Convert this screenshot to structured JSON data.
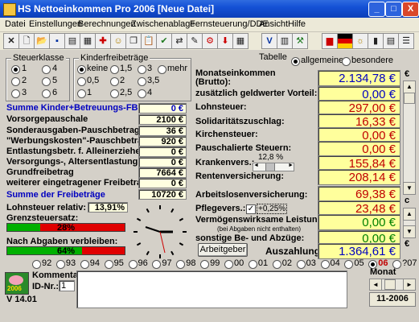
{
  "window": {
    "title": "HS  Nettoeinkommen Pro 2006 [Neue Datei]",
    "btn_min": "_",
    "btn_max": "□",
    "btn_close": "X"
  },
  "menu": [
    "Datei",
    "Einstellungen",
    "Berechnungen",
    "Zwischenablage",
    "Fernsteuerung/DDE",
    "Ansicht",
    "Hilfe"
  ],
  "steuerklasse": {
    "title": "Steuerklasse",
    "options": [
      "1",
      "2",
      "3",
      "4",
      "5",
      "6"
    ],
    "selected": "1"
  },
  "kinder": {
    "title": "Kinderfreibeträge",
    "options": [
      "keine",
      "1,5",
      "3",
      "mehr",
      "0,5",
      "2",
      "3,5",
      "1",
      "2,5",
      "4"
    ],
    "selected": "keine"
  },
  "tabelle": {
    "title": "Tabelle",
    "options": [
      "allgemeine",
      "besondere"
    ],
    "selected": "allgemeine"
  },
  "left_rows": [
    {
      "label": "Summe Kinder+Betreuungs-FB",
      "value": "0 €",
      "blue": true
    },
    {
      "label": "Vorsorgepauschale",
      "value": "2100 €"
    },
    {
      "label": "Sonderausgaben-Pauschbetrag",
      "value": "36 €"
    },
    {
      "label": "\"Werbungskosten\"-Pauschbetrag",
      "value": "920 €"
    },
    {
      "label": "Entlastungsbetr. f. Alleinerziehende",
      "value": "0 €"
    },
    {
      "label": "Versorgungs-, Altersentlastungs-FB",
      "value": "0 €"
    },
    {
      "label": "Grundfreibetrag",
      "value": "7664 €"
    },
    {
      "label": "weiterer eingetragener Freibetrag",
      "value": "0 €"
    }
  ],
  "summe_freibetraege": {
    "label": "Summe der Freibeträge",
    "value": "10720 €"
  },
  "lohnsteuer_relativ": {
    "label": "Lohnsteuer relativ:",
    "value": "13,91%"
  },
  "grenzsteuersatz": {
    "label": "Grenzsteuersatz:",
    "text": "28%",
    "fraction": 0.28
  },
  "abgaben": {
    "label": "Nach Abgaben verbleiben:",
    "text": "64%",
    "fraction": 0.64
  },
  "right_rows": [
    {
      "label": "Monatseinkommen\n(Brutto):",
      "value": "2.134,78 €",
      "color": "blue"
    },
    {
      "label": "zusätzlich geldwerter Vorteil:",
      "value": "0,00 €",
      "color": "blue"
    },
    {
      "label": "Lohnsteuer:",
      "value": "297,00 €",
      "color": "red"
    },
    {
      "label": "Solidaritätszuschlag:",
      "value": "16,33 €",
      "color": "red"
    },
    {
      "label": "Kirchensteuer:",
      "value": "0,00 €",
      "color": "red"
    },
    {
      "label": "Pauschalierte Steuern:",
      "value": "0,00 €",
      "color": "red"
    },
    {
      "label": "Krankenvers.:",
      "value": "155,84 €",
      "color": "red"
    },
    {
      "label": "Rentenversicherung:",
      "value": "208,14 €",
      "color": "red"
    },
    {
      "label": "Arbeitslosenversicherung:",
      "value": "69,38 €",
      "color": "red"
    },
    {
      "label": "Pflegevers.:",
      "value": "23,48 €",
      "color": "red"
    },
    {
      "label": "Vermögenswirksame Leistungen:",
      "value": "0,00 €",
      "color": "green"
    },
    {
      "label": "sonstige Be- und Abzüge:",
      "value": "0,00 €",
      "color": "green"
    }
  ],
  "kv_rate": "12,8 %",
  "pflege_check": "+0,25%",
  "vwl_note": "(bei Abgaben nicht enthalten)",
  "arbeitgeber_btn": "Arbeitgeber",
  "auszahlung": {
    "label": "Auszahlung:",
    "value": "1.364,61 €"
  },
  "scroll_labels": {
    "euro_top": "€",
    "euro_bottom": "€",
    "c": "c"
  },
  "years": [
    "92",
    "93",
    "94",
    "95",
    "96",
    "97",
    "98",
    "99",
    "00",
    "01",
    "02",
    "03",
    "04",
    "05",
    "06",
    "?07"
  ],
  "selected_year": "06",
  "kommentar": {
    "label": "Kommentar:",
    "value": ""
  },
  "idnr": {
    "label": "ID-Nr.:",
    "value": "1"
  },
  "version": "V 14.01",
  "logo_text": "2006",
  "monat": {
    "label": "Monat",
    "value": "11-2006"
  },
  "colors": {
    "title_blue": "#1451d6",
    "value_bg": "#ffff9c",
    "red": "#c00000",
    "blue": "#0000c0",
    "green": "#008000"
  }
}
